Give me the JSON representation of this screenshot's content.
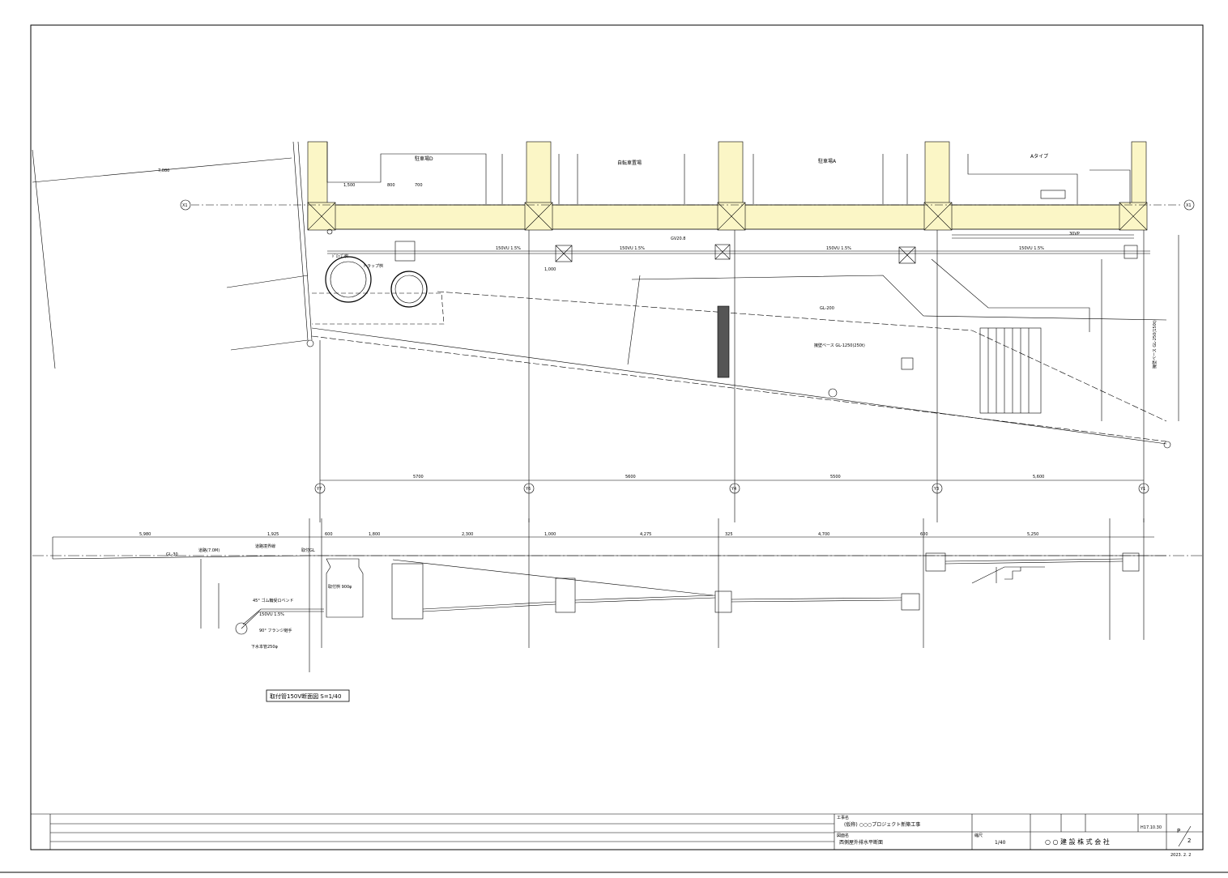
{
  "plan": {
    "rooms": [
      "駐車場D",
      "自転車置場",
      "駐車場A",
      "Aタイプ"
    ],
    "grid_x": "X1",
    "grid_y": [
      "Y7",
      "Y6",
      "Y4",
      "Y3",
      "Y1"
    ],
    "spans": [
      "5700",
      "5600",
      "5500",
      "5,600"
    ],
    "labels": {
      "road": "7,080",
      "pipe1": "150VU 1.5%",
      "pipe2": "150VU 1.5%",
      "pipe3": "150VU 1.5%",
      "pipe4": "150VU 1.5%",
      "drop": "ﾄﾞﾛｯﾌﾟ桝",
      "trap": "トラップ桝",
      "gv": "GV20.8",
      "v30": "30VP",
      "base1": "擁壁ベース GL-1250(250t)",
      "base2": "擁壁ベース GL-250(150t)",
      "dim_1500": "1,500",
      "dim_800": "800",
      "dim_700": "700",
      "dim_1000": "1,000",
      "gl": "GL-200"
    }
  },
  "section": {
    "road": "道路(7.0M)",
    "boundary": "道路境界線",
    "gl": "取付GL",
    "gl_left": "GL-30",
    "bend": "45° ゴム輪受ロベンド",
    "pipe": "150VU 1.5%",
    "flange": "90° フランジ継手",
    "sewer": "下水本管250φ",
    "inlet": "取付桝 900φ",
    "dims": [
      "5,980",
      "1,925",
      "600",
      "1,800",
      "2,300",
      "1,000",
      "4,275",
      "325",
      "4,700",
      "600",
      "5,250"
    ],
    "title": "取付管150V断面図 S=1/40"
  },
  "titleblock": {
    "project_label": "工事名",
    "project": "(仮称) ○○○プロジェクト新築工事",
    "drawing_label": "図面名",
    "drawing": "西側屋外排水平断面",
    "scale_label": "縮尺",
    "scale": "1/40",
    "company": "○ ○ 建 設 株 式 会 社",
    "date": "H17.10.30",
    "page_top": "P",
    "page_num": "2",
    "print_date": "2023. 2. 2"
  }
}
